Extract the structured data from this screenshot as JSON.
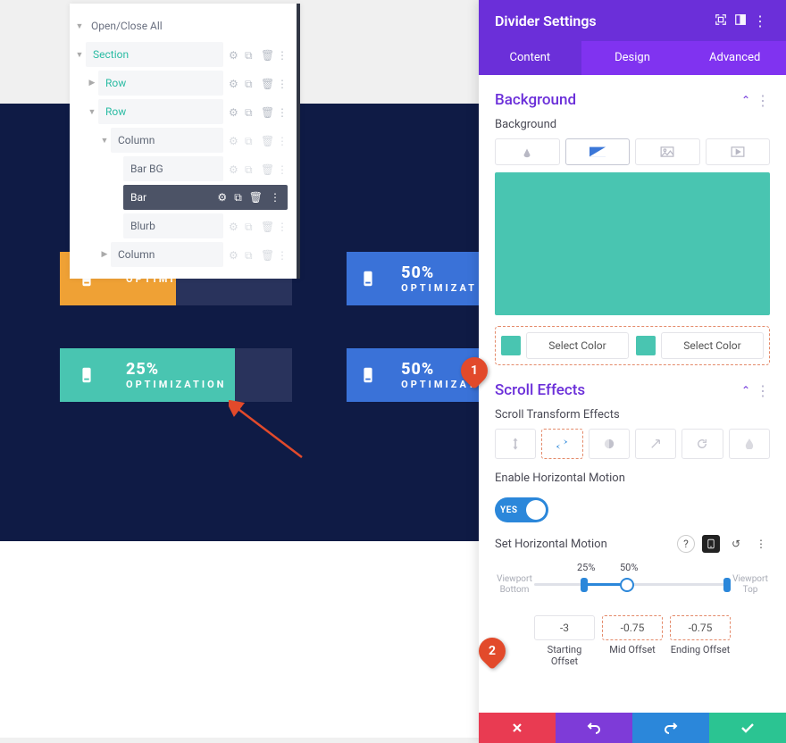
{
  "layers": {
    "toggle_all": "Open/Close All",
    "items": [
      {
        "label": "Section",
        "teal": true,
        "indent": 0
      },
      {
        "label": "Row",
        "teal": true,
        "indent": 1
      },
      {
        "label": "Row",
        "teal": true,
        "indent": 1
      },
      {
        "label": "Column",
        "indent": 2
      },
      {
        "label": "Bar BG",
        "indent": 3
      },
      {
        "label": "Bar",
        "indent": 3,
        "active": true
      },
      {
        "label": "Blurb",
        "indent": 3
      },
      {
        "label": "Column",
        "indent": 2
      }
    ]
  },
  "preview": {
    "cards": [
      {
        "pct": "50%",
        "lbl": "OPTIMIZAT"
      },
      {
        "pct": "25%",
        "lbl": "OPTIMIZATION"
      },
      {
        "pct": "50%",
        "lbl": "OPTIMIZAT"
      }
    ],
    "hidden_lbl": "OPTIMIZATION"
  },
  "panel": {
    "title": "Divider Settings",
    "tabs": [
      "Content",
      "Design",
      "Advanced"
    ],
    "bg": {
      "title": "Background",
      "label": "Background",
      "select_color": "Select Color"
    },
    "scroll": {
      "title": "Scroll Effects",
      "trans_label": "Scroll Transform Effects",
      "enable_label": "Enable Horizontal Motion",
      "toggle": "YES",
      "set_label": "Set Horizontal Motion",
      "vp_bottom": "Viewport Bottom",
      "vp_top": "Viewport Top",
      "tick_25": "25%",
      "tick_50": "50%",
      "offsets": {
        "start": {
          "val": "-3",
          "lbl": "Starting Offset"
        },
        "mid": {
          "val": "-0.75",
          "lbl": "Mid Offset"
        },
        "end": {
          "val": "-0.75",
          "lbl": "Ending Offset"
        }
      }
    }
  },
  "markers": {
    "m1": "1",
    "m2": "2"
  },
  "colors": {
    "teal": "#49c5b1"
  }
}
